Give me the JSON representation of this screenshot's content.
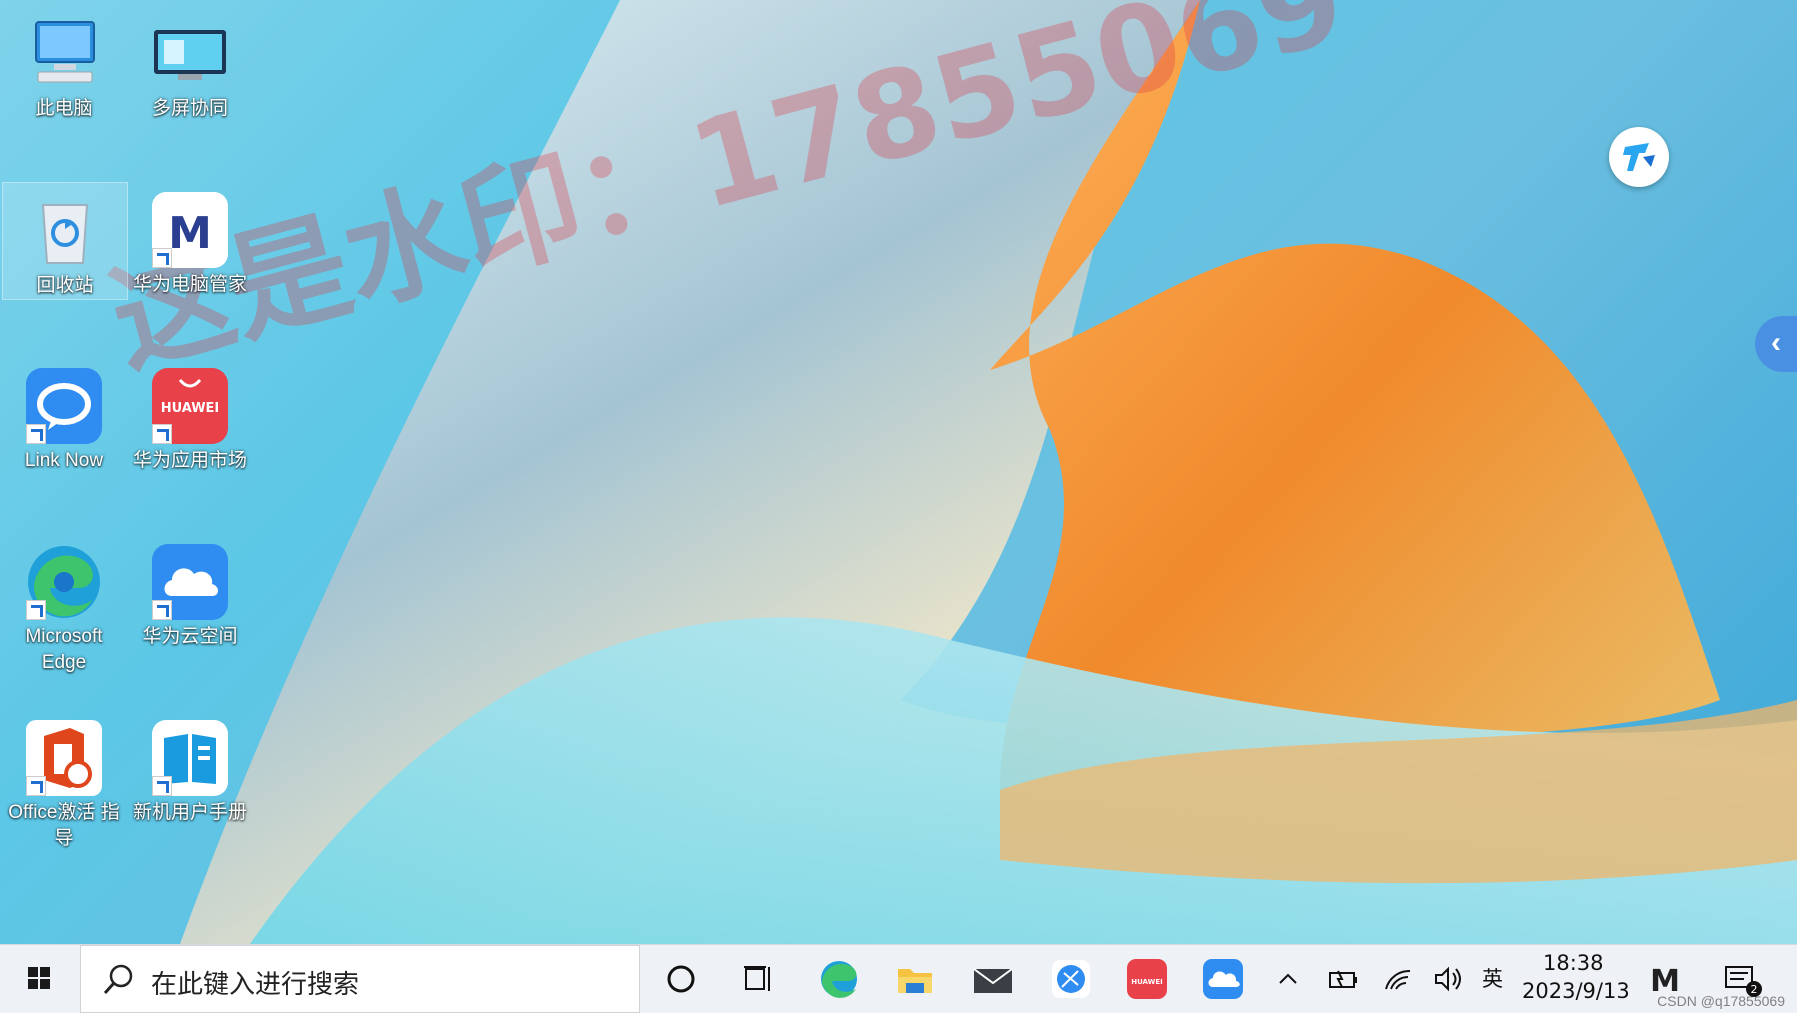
{
  "desktop": {
    "watermark_text": "这是水印：17855069",
    "icons": [
      {
        "label": "此电脑",
        "icon": "computer-icon"
      },
      {
        "label": "多屏协同",
        "icon": "multi-screen-icon"
      },
      {
        "label": "回收站",
        "icon": "recycle-bin-icon"
      },
      {
        "label": "华为电脑管家",
        "icon": "pc-manager-icon"
      },
      {
        "label": "Link Now",
        "icon": "link-now-icon"
      },
      {
        "label": "华为应用市场",
        "icon": "appgallery-icon"
      },
      {
        "label": "Microsoft Edge",
        "icon": "edge-icon"
      },
      {
        "label": "华为云空间",
        "icon": "cloud-icon"
      },
      {
        "label": "Office激活 指导",
        "icon": "office-icon"
      },
      {
        "label": "新机用户手册",
        "icon": "manual-icon"
      }
    ],
    "side_tab_glyph": "‹"
  },
  "taskbar": {
    "search_placeholder": "在此键入进行搜索",
    "appgallery_badge": "HUAWEI",
    "ime": "英",
    "time": "18:38",
    "date": "2023/9/13",
    "notification_count": "2",
    "pinned": [
      "cortana-icon",
      "task-view-icon",
      "edge-icon",
      "file-explorer-icon",
      "mail-icon",
      "browser-icon",
      "appgallery-icon",
      "cloud-icon"
    ],
    "tray": [
      "chevron-up-icon",
      "battery-icon",
      "wifi-icon",
      "volume-icon",
      "pc-manager-icon",
      "notification-icon"
    ]
  },
  "footer": {
    "csdn": "CSDN @q17855069"
  },
  "colors": {
    "accent": "#4a90e2",
    "taskbar": "#eef1f5",
    "watermark": "#dc3c46"
  }
}
